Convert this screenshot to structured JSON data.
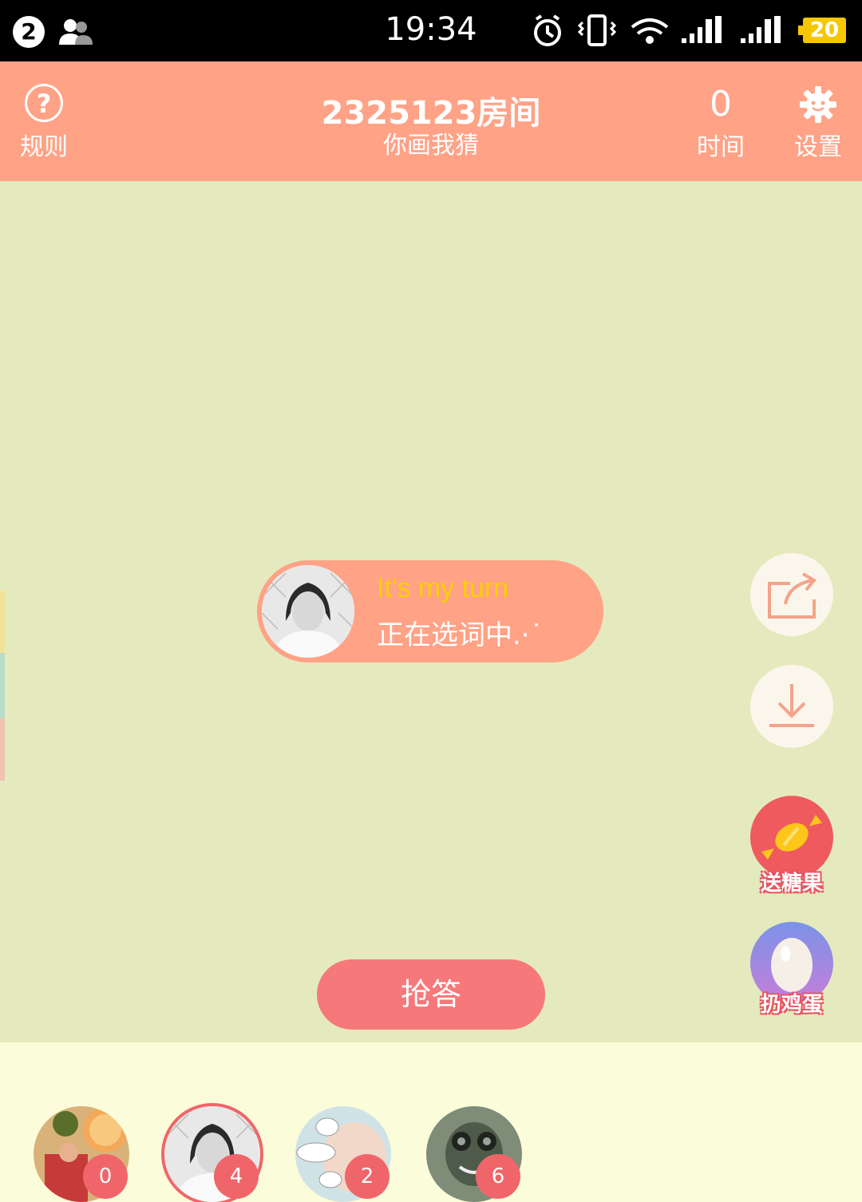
{
  "status_bar": {
    "notification_count": "2",
    "time": "19:34",
    "battery": "20",
    "icons": [
      "users-icon",
      "alarm-icon",
      "vibrate-icon",
      "wifi-icon",
      "signal-2-icon",
      "signal-1-icon"
    ]
  },
  "header": {
    "rules_label": "规则",
    "room_title": "2325123房间",
    "game_name": "你画我猜",
    "timer_value": "0",
    "timer_label": "时间",
    "settings_label": "设置"
  },
  "turn": {
    "text_en": "It's my turn",
    "text_cn": "正在选词中.·˙"
  },
  "side_actions": {
    "candy_label": "送糖果",
    "egg_label": "扔鸡蛋"
  },
  "answer_button": "抢答",
  "players": [
    {
      "score": "0",
      "active": false
    },
    {
      "score": "4",
      "active": true
    },
    {
      "score": "2",
      "active": false
    },
    {
      "score": "6",
      "active": false
    }
  ],
  "colors": {
    "header": "#FFA286",
    "canvas": "#E4EABD",
    "bottom": "#FBFCD9",
    "accent_red": "#F0656A",
    "turn_yellow": "#F9D000"
  }
}
